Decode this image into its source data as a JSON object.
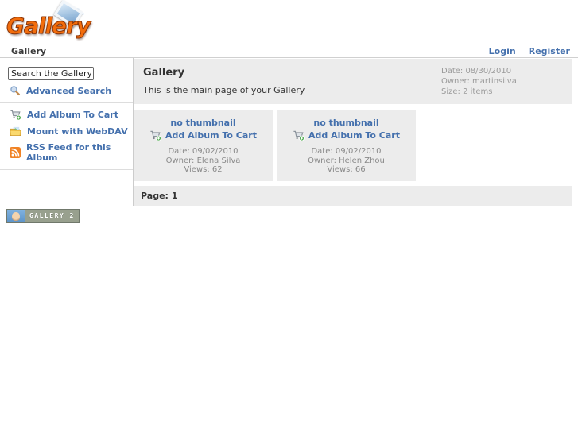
{
  "app": {
    "logo_text": "Gallery"
  },
  "breadcrumb": {
    "title": "Gallery"
  },
  "user_links": {
    "login": "Login",
    "register": "Register"
  },
  "sidebar": {
    "search": {
      "value": "Search the Gallery"
    },
    "advanced_search_label": "Advanced Search",
    "actions": [
      {
        "icon": "cart-icon",
        "label": "Add Album To Cart"
      },
      {
        "icon": "webdav-icon",
        "label": "Mount with WebDAV"
      },
      {
        "icon": "rss-icon",
        "label": "RSS Feed for this Album"
      }
    ]
  },
  "main": {
    "title": "Gallery",
    "subtitle": "This is the main page of your Gallery",
    "meta": {
      "date": "Date: 08/30/2010",
      "owner": "Owner: martinsilva",
      "size": "Size: 2 items"
    },
    "albums": [
      {
        "thumbnail_label": "no thumbnail",
        "cart_label": "Add Album To Cart",
        "date": "Date: 09/02/2010",
        "owner": "Owner: Elena Silva",
        "views": "Views: 62"
      },
      {
        "thumbnail_label": "no thumbnail",
        "cart_label": "Add Album To Cart",
        "date": "Date: 09/02/2010",
        "owner": "Owner: Helen Zhou",
        "views": "Views: 66"
      }
    ],
    "pager": "Page: 1"
  },
  "footer": {
    "badge_label": "GALLERY 2"
  },
  "colors": {
    "link_blue": "#4470ad",
    "block_bg": "#ececec",
    "meta_text": "#9b9b9b",
    "logo_orange": "#f26d0c",
    "rss_orange": "#f08224",
    "badge_bg": "#98a08e"
  }
}
